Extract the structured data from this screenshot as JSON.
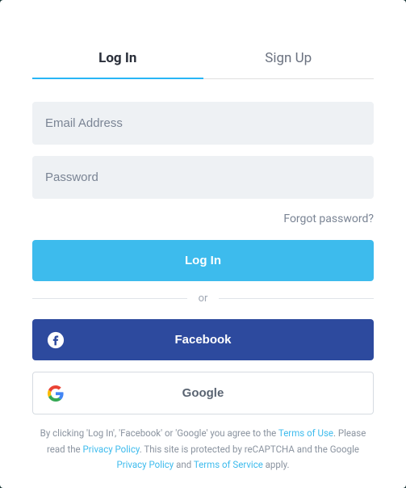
{
  "tabs": {
    "login": "Log In",
    "signup": "Sign Up"
  },
  "form": {
    "email_placeholder": "Email Address",
    "password_placeholder": "Password",
    "forgot_label": "Forgot password?"
  },
  "buttons": {
    "login": "Log In",
    "facebook": "Facebook",
    "google": "Google"
  },
  "divider": {
    "label": "or"
  },
  "legal": {
    "prefix": "By clicking 'Log In', 'Facebook' or 'Google' you agree to the ",
    "terms_of_use": "Terms of Use",
    "please_read": ". Please read the ",
    "privacy_policy": "Privacy Policy",
    "recaptcha": ". This site is protected by reCAPTCHA and the Google ",
    "google_privacy": "Privacy Policy",
    "and": " and ",
    "google_tos": "Terms of Service",
    "apply": " apply."
  },
  "icons": {
    "facebook": "facebook-icon",
    "google": "google-icon"
  },
  "colors": {
    "accent": "#3DBBED",
    "facebook": "#2d4a9e"
  }
}
